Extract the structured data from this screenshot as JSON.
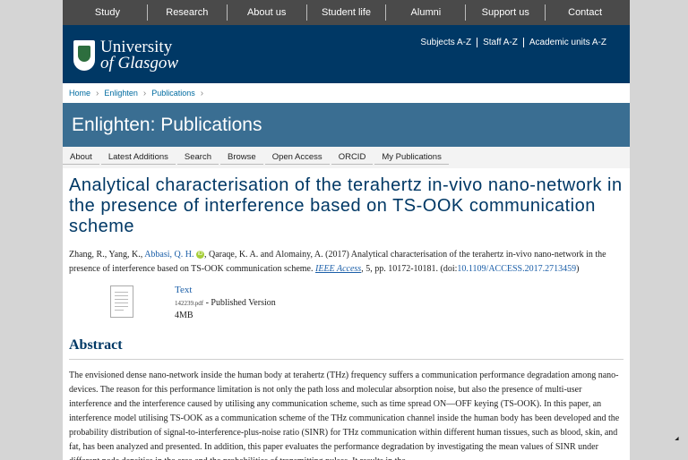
{
  "topnav": {
    "items": [
      "Study",
      "Research",
      "About us",
      "Student life",
      "Alumni",
      "Support us",
      "Contact"
    ]
  },
  "header": {
    "logo_line1": "University",
    "logo_line2": "of Glasgow",
    "links": [
      "Subjects A-Z",
      "Staff A-Z",
      "Academic units A-Z"
    ]
  },
  "breadcrumb": [
    "Home",
    "Enlighten",
    "Publications"
  ],
  "banner": {
    "title": "Enlighten: Publications"
  },
  "subnav": {
    "items": [
      "About",
      "Latest Additions",
      "Search",
      "Browse",
      "Open Access",
      "ORCID",
      "My Publications"
    ]
  },
  "record": {
    "title": "Analytical characterisation of the terahertz in-vivo nano-network in the presence of interference based on TS-OOK communication scheme",
    "authors_pre": "Zhang, R., Yang, K., ",
    "author_link": "Abbasi, Q. H.",
    "authors_post": ", Qaraqe, K. A. and Alomainy, A. (2017) Analytical characterisation of the terahertz in-vivo nano-network in the presence of interference based on TS-OOK communication scheme. ",
    "journal": "IEEE Access",
    "volume_pages": ", 5, pp. 10172-10181. (doi:",
    "doi": "10.1109/ACCESS.2017.2713459",
    "doi_close": ")",
    "orcid_icon": "iD"
  },
  "file": {
    "type": "Text",
    "filename": "142239.pdf",
    "version": " - Published Version",
    "size": "4MB"
  },
  "abstract": {
    "heading": "Abstract",
    "text": "The envisioned dense nano-network inside the human body at terahertz (THz) frequency suffers a communication performance degradation among nano-devices. The reason for this performance limitation is not only the path loss and molecular absorption noise, but also the presence of multi-user interference and the interference caused by utilising any communication scheme, such as time spread ON—OFF keying (TS-OOK). In this paper, an interference model utilising TS-OOK as a communication scheme of the THz communication channel inside the human body has been developed and the probability distribution of signal-to-interference-plus-noise ratio (SINR) for THz communication within different human tissues, such as blood, skin, and fat, has been analyzed and presented. In addition, this paper evaluates the performance degradation by investigating the mean values of SINR under different node densities in the area and the probabilities of transmitting pulses. It results in the"
  }
}
